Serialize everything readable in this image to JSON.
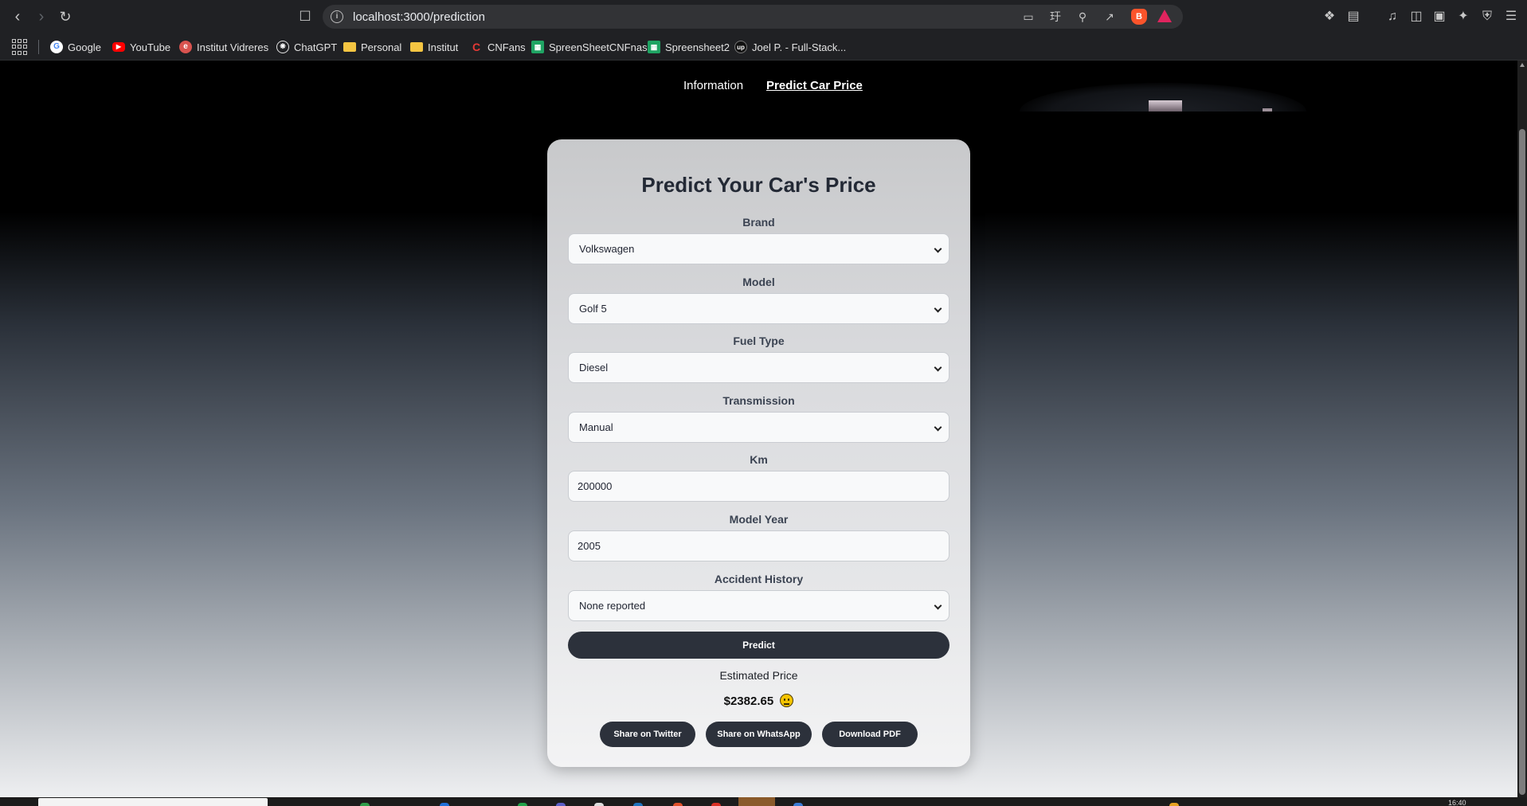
{
  "browser": {
    "url": "localhost:3000/prediction",
    "bookmarks": [
      {
        "label": "Google",
        "icon": "google-icon"
      },
      {
        "label": "YouTube",
        "icon": "youtube-icon"
      },
      {
        "label": "Institut Vidreres",
        "icon": "vidreres-icon"
      },
      {
        "label": "ChatGPT",
        "icon": "chatgpt-icon"
      },
      {
        "label": "Personal",
        "icon": "folder-icon"
      },
      {
        "label": "Institut",
        "icon": "folder-icon"
      },
      {
        "label": "CNFans",
        "icon": "cnfans-icon"
      },
      {
        "label": "SpreenSheetCNFnas",
        "icon": "sheets-icon"
      },
      {
        "label": "Spreensheet2",
        "icon": "sheets-icon"
      },
      {
        "label": "Joel P. - Full-Stack...",
        "icon": "upwork-icon"
      }
    ]
  },
  "site_nav": {
    "information": "Information",
    "predict": "Predict Car Price"
  },
  "form": {
    "title": "Predict Your Car's Price",
    "fields": [
      {
        "label": "Brand",
        "value": "Volkswagen",
        "type": "select"
      },
      {
        "label": "Model",
        "value": "Golf 5",
        "type": "select"
      },
      {
        "label": "Fuel Type",
        "value": "Diesel",
        "type": "select"
      },
      {
        "label": "Transmission",
        "value": "Manual",
        "type": "select"
      },
      {
        "label": "Km",
        "value": "200000",
        "type": "input"
      },
      {
        "label": "Model Year",
        "value": "2005",
        "type": "input"
      },
      {
        "label": "Accident History",
        "value": "None reported",
        "type": "select"
      }
    ],
    "predict_label": "Predict"
  },
  "result": {
    "label": "Estimated Price",
    "price": "$2382.65",
    "emoji": "neutral-face-icon"
  },
  "share": {
    "twitter": "Share on Twitter",
    "whatsapp": "Share on WhatsApp",
    "pdf": "Download PDF"
  },
  "taskbar": {
    "clock": "16:40"
  },
  "colors": {
    "button_dark": "#2c313b",
    "title_text": "#232935",
    "page_top": "#000000",
    "page_bottom": "#eeeff1"
  }
}
